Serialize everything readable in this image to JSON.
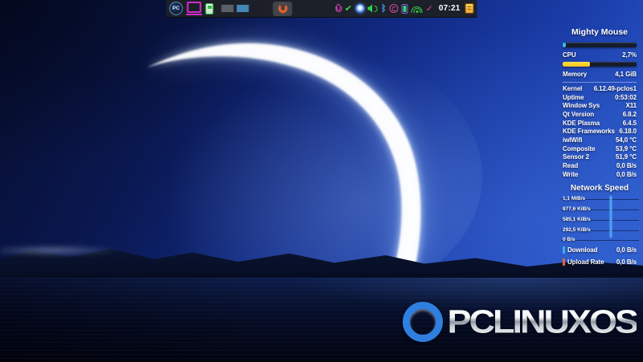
{
  "panel": {
    "launcher": {
      "pc_label": "PC",
      "icons": [
        "pclinuxos-menu",
        "laptop",
        "package-manager"
      ]
    },
    "pager": {
      "desktops": 2,
      "active_index": 2
    },
    "task": {
      "icon": "orange-horseshoe-app"
    },
    "tray_icons": [
      "microphone",
      "checkmark",
      "status-orb",
      "volume",
      "bluetooth",
      "disc",
      "kde-connect-phone",
      "wifi",
      "updates-check",
      "clock",
      "clipboard"
    ],
    "checkmark_glyph": "✔",
    "bluetooth_glyph": "ᛒ",
    "vcheck_glyph": "✓",
    "clock": "07:21"
  },
  "widget": {
    "title": "Mighty Mouse",
    "cpu": {
      "label": "CPU",
      "value": "2,7%",
      "bar_style": "width:4%",
      "color": "#35b9e9"
    },
    "memory": {
      "label": "Memory",
      "value": "4,1 GiB",
      "bar_style": "width:37%",
      "color": "#fdd535"
    },
    "info_rows": [
      {
        "label": "Kernel",
        "value": "6.12.49-pclos1"
      },
      {
        "label": "Uptime",
        "value": "0:53:02"
      },
      {
        "label": "Window Sys",
        "value": "X11"
      },
      {
        "label": "Qt Version",
        "value": "6.8.2"
      },
      {
        "label": "KDE Plasma",
        "value": "6.4.5"
      },
      {
        "label": "KDE Frameworks",
        "value": "6.18.0"
      },
      {
        "label": "iwlWifi",
        "value": "54,0 °C"
      },
      {
        "label": "Composite",
        "value": "53,9 °C"
      },
      {
        "label": "Sensor 2",
        "value": "51,9 °C"
      },
      {
        "label": "Read",
        "value": "0,0 B/s"
      },
      {
        "label": "Write",
        "value": "0,0 B/s"
      }
    ],
    "network": {
      "title": "Network Speed",
      "y_labels": [
        "1,1 MiB/s",
        "877,6 KiB/s",
        "585,1 KiB/s",
        "292,5 KiB/s",
        "0 B/s"
      ],
      "spike_style": "left:63%",
      "spike_color": "#4aa6f0",
      "download": {
        "label": "Download",
        "value": "0,0 B/s",
        "color": "#3daee9"
      },
      "upload": {
        "label": "Upload Rate",
        "value": "0,0 B/s",
        "color": "#e8622c"
      }
    }
  },
  "logo": {
    "text": "PCLINUXOS",
    "ring_color": "#2f7fe0"
  }
}
